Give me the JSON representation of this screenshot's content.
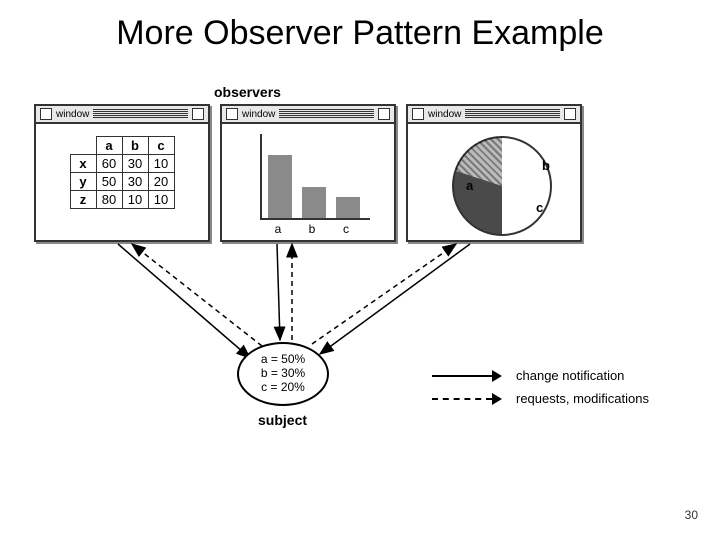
{
  "title": "More Observer Pattern Example",
  "observers_label": "observers",
  "subject_label": "subject",
  "page_number": "30",
  "window_label": "window",
  "table": {
    "cols": [
      "a",
      "b",
      "c"
    ],
    "rows": [
      "x",
      "y",
      "z"
    ],
    "data": [
      [
        60,
        30,
        10
      ],
      [
        50,
        30,
        20
      ],
      [
        80,
        10,
        10
      ]
    ]
  },
  "chart_data": {
    "bar": {
      "type": "bar",
      "categories": [
        "a",
        "b",
        "c"
      ],
      "values": [
        60,
        30,
        20
      ],
      "ylim": [
        0,
        80
      ]
    },
    "pie": {
      "type": "pie",
      "slices": [
        {
          "label": "a",
          "value": 50
        },
        {
          "label": "b",
          "value": 30
        },
        {
          "label": "c",
          "value": 20
        }
      ]
    }
  },
  "subject": {
    "line1": "a = 50%",
    "line2": "b = 30%",
    "line3": "c = 20%"
  },
  "legend": {
    "solid": "change notification",
    "dashed": "requests, modifications"
  }
}
